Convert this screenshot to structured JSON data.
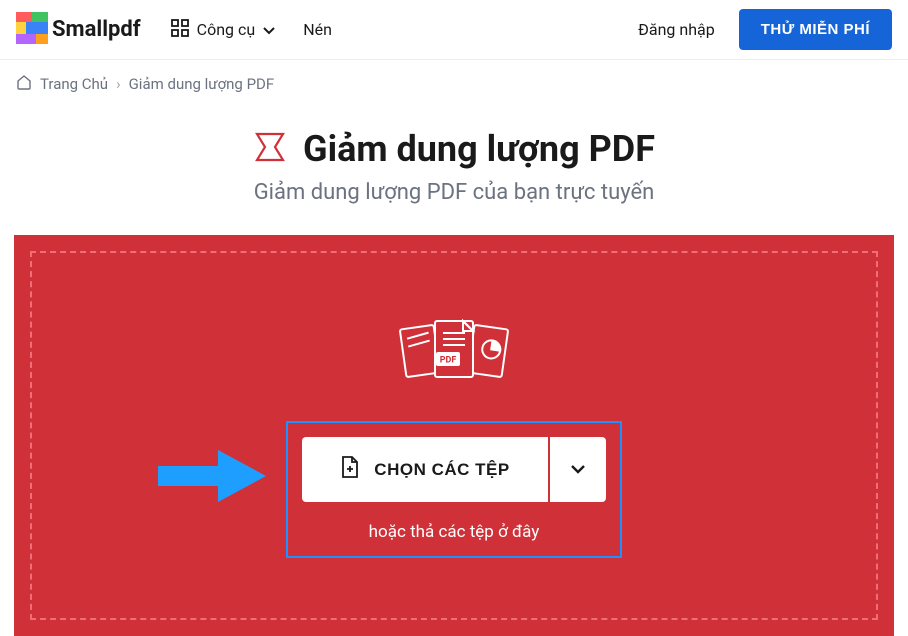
{
  "header": {
    "brand": "Smallpdf",
    "nav": {
      "tools": "Công cụ",
      "compress": "Nén"
    },
    "login": "Đăng nhập",
    "cta": "THỬ MIỄN PHÍ"
  },
  "breadcrumb": {
    "home": "Trang Chủ",
    "current": "Giảm dung lượng PDF"
  },
  "title": {
    "heading": "Giảm dung lượng PDF",
    "subtitle": "Giảm dung lượng PDF của bạn trực tuyến"
  },
  "upload": {
    "button": "CHỌN CÁC TỆP",
    "drop_hint": "hoặc thả các tệp ở đây"
  }
}
